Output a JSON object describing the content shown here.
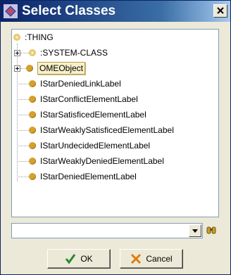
{
  "window": {
    "title": "Select Classes"
  },
  "tree": {
    "root": ":THING",
    "nodes": [
      {
        "label": ":SYSTEM-CLASS"
      },
      {
        "label": "OMEObject"
      },
      {
        "label": "IStarDeniedLinkLabel"
      },
      {
        "label": "IStarConflictElementLabel"
      },
      {
        "label": "IStarSatisficedElementLabel"
      },
      {
        "label": "IStarWeaklySatisficedElementLabel"
      },
      {
        "label": "IStarUndecidedElementLabel"
      },
      {
        "label": "IStarWeaklyDeniedElementLabel"
      },
      {
        "label": "IStarDeniedElementLabel"
      }
    ]
  },
  "search": {
    "value": ""
  },
  "buttons": {
    "ok": "OK",
    "cancel": "Cancel"
  }
}
